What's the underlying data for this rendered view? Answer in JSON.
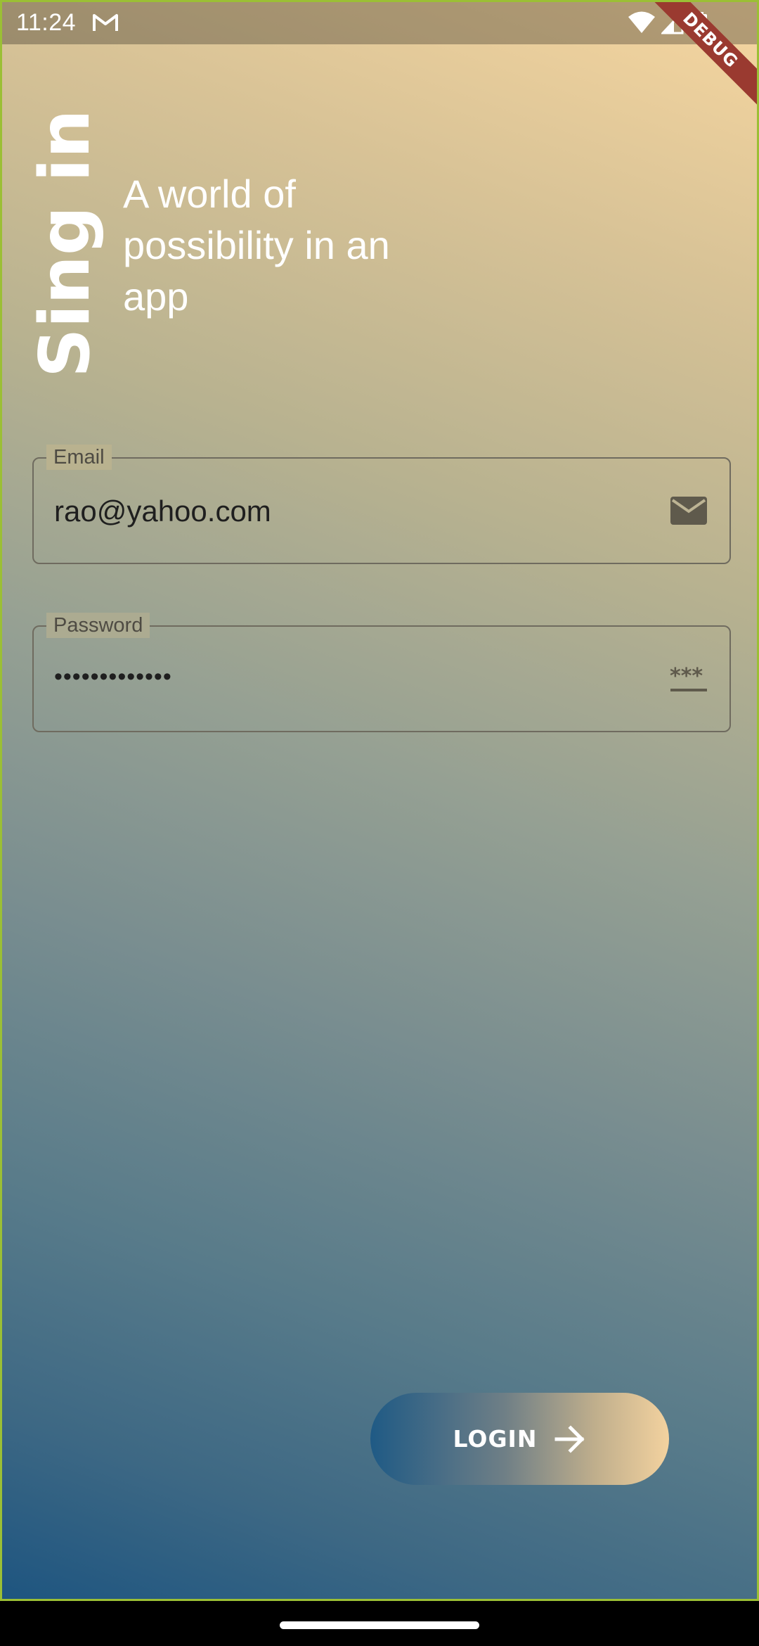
{
  "status_bar": {
    "time": "11:24",
    "notification_icon": "gmail-icon",
    "icons": [
      "wifi-icon",
      "signal-icon",
      "battery-icon"
    ]
  },
  "debug_ribbon": "DEBUG",
  "header": {
    "title": "Sing in",
    "tagline": "A world of possibility in an app"
  },
  "form": {
    "email": {
      "label": "Email",
      "value": "rao@yahoo.com",
      "icon": "mail-icon"
    },
    "password": {
      "label": "Password",
      "value": "•••••••••••••",
      "icon": "password-icon"
    }
  },
  "login_button": {
    "label": "LOGIN",
    "icon": "arrow-forward-icon"
  },
  "colors": {
    "gradient_top": "#f6d6a0",
    "gradient_bottom": "#1e5580",
    "debug_ribbon": "#9a3a30",
    "border_accent": "#9bbf35"
  }
}
